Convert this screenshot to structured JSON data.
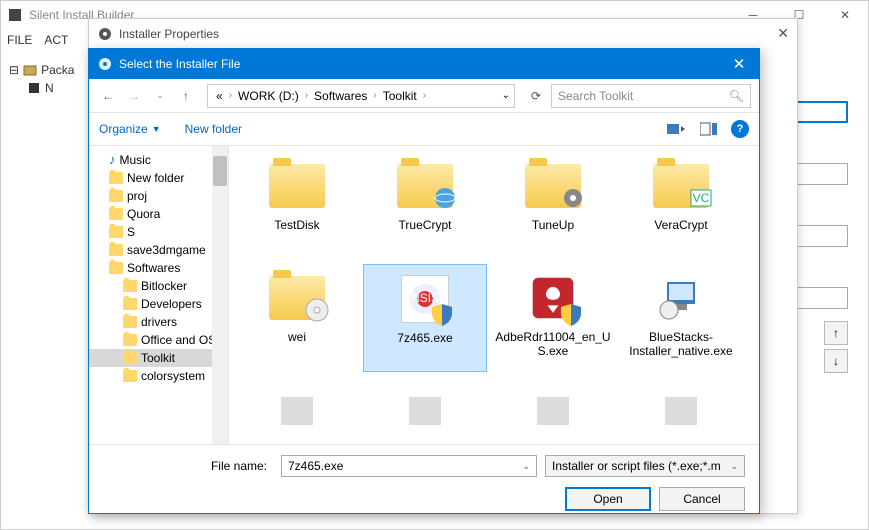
{
  "bg": {
    "title": "Silent Install Builder",
    "menu": [
      "FILE",
      "ACT"
    ],
    "tree": {
      "pack": "Packa",
      "item": "N"
    }
  },
  "props": {
    "title": "Installer Properties"
  },
  "dialog": {
    "title": "Select the Installer File",
    "breadcrumb": {
      "drive_icon": "«",
      "parts": [
        "WORK (D:)",
        "Softwares",
        "Toolkit"
      ]
    },
    "search_placeholder": "Search Toolkit",
    "organize": "Organize",
    "newfolder": "New folder",
    "sidebar": [
      {
        "label": "Music",
        "type": "music",
        "indent": 1
      },
      {
        "label": "New folder",
        "type": "folder",
        "indent": 1
      },
      {
        "label": "proj",
        "type": "folder",
        "indent": 1
      },
      {
        "label": "Quora",
        "type": "folder",
        "indent": 1
      },
      {
        "label": "S",
        "type": "folder",
        "indent": 1
      },
      {
        "label": "save3dmgame",
        "type": "folder",
        "indent": 1
      },
      {
        "label": "Softwares",
        "type": "folder",
        "indent": 1
      },
      {
        "label": "Bitlocker",
        "type": "folder",
        "indent": 2
      },
      {
        "label": "Developers",
        "type": "folder",
        "indent": 2
      },
      {
        "label": "drivers",
        "type": "folder",
        "indent": 2
      },
      {
        "label": "Office and OS",
        "type": "folder",
        "indent": 2
      },
      {
        "label": "Toolkit",
        "type": "folder",
        "indent": 2,
        "selected": true
      },
      {
        "label": "colorsystem",
        "type": "folder",
        "indent": 2
      }
    ],
    "files": [
      {
        "name": "TestDisk",
        "kind": "folder"
      },
      {
        "name": "TrueCrypt",
        "kind": "folder",
        "insert": "globe"
      },
      {
        "name": "TuneUp",
        "kind": "folder",
        "insert": "gear"
      },
      {
        "name": "VeraCrypt",
        "kind": "folder",
        "insert": "vc"
      },
      {
        "name": "wei",
        "kind": "folder",
        "insert": "disc"
      },
      {
        "name": "7z465.exe",
        "kind": "exe",
        "icon": "nsis",
        "selected": true
      },
      {
        "name": "AdbeRdr11004_en_US.exe",
        "kind": "exe",
        "icon": "adobe"
      },
      {
        "name": "BlueStacks-Installer_native.exe",
        "kind": "exe",
        "icon": "bluestacks"
      },
      {
        "name": "",
        "kind": "exe",
        "icon": "blank1"
      },
      {
        "name": "",
        "kind": "exe",
        "icon": "blank2"
      },
      {
        "name": "",
        "kind": "exe",
        "icon": "blank3"
      },
      {
        "name": "",
        "kind": "exe",
        "icon": "blank4"
      }
    ],
    "filename_label": "File name:",
    "filename_value": "7z465.exe",
    "filter": "Installer or script files (*.exe;*.m",
    "open": "Open",
    "cancel": "Cancel"
  }
}
